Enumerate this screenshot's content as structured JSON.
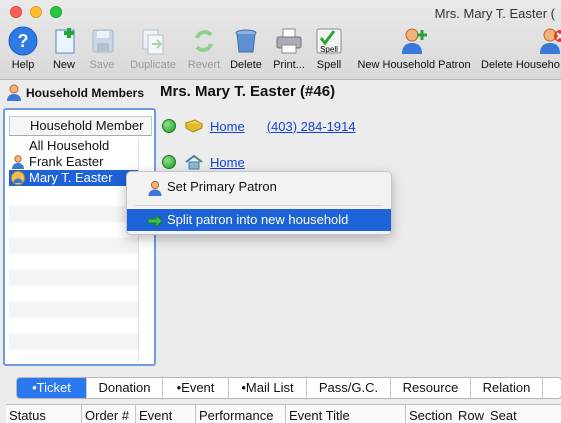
{
  "window": {
    "title": "Mrs. Mary T. Easter ("
  },
  "toolbar": [
    {
      "label": "Help",
      "icon": "help-icon",
      "enabled": true
    },
    {
      "label": "New",
      "icon": "new-document-icon",
      "enabled": true
    },
    {
      "label": "Save",
      "icon": "save-disk-icon",
      "enabled": false
    },
    {
      "label": "Duplicate",
      "icon": "duplicate-icon",
      "enabled": false
    },
    {
      "label": "Revert",
      "icon": "revert-arrows-icon",
      "enabled": false
    },
    {
      "label": "Delete",
      "icon": "trash-can-icon",
      "enabled": true
    },
    {
      "label": "Print...",
      "icon": "printer-icon",
      "enabled": true
    },
    {
      "label": "Spell",
      "icon": "spell-check-icon",
      "icon_text": "Spell",
      "enabled": true
    },
    {
      "label": "New Household Patron",
      "icon": "add-person-icon",
      "enabled": true
    },
    {
      "label": "Delete Househo",
      "icon": "delete-person-icon",
      "enabled": true
    }
  ],
  "household_panel": {
    "title": "Household Members",
    "column_header": "Household Member",
    "rows": [
      {
        "name": "All Household",
        "icon": null,
        "selected": false
      },
      {
        "name": "Frank Easter",
        "icon": "person-icon",
        "selected": false
      },
      {
        "name": "Mary T. Easter",
        "icon": "primary-patron-icon",
        "selected": true
      }
    ]
  },
  "patron": {
    "heading": "Mrs. Mary T. Easter (#46)",
    "addresses": [
      {
        "label": "Home",
        "phone": "(403) 284-1914",
        "icon": "mail-envelope-icon"
      },
      {
        "label": "Home",
        "phone": "",
        "icon": "house-icon"
      }
    ]
  },
  "context_menu": {
    "items": [
      {
        "label": "Set Primary Patron",
        "icon": "person-icon",
        "highlighted": false
      },
      {
        "label": "Split patron into new household",
        "icon": "green-arrow-icon",
        "highlighted": true
      }
    ]
  },
  "tabs": [
    {
      "label": "•Ticket",
      "active": true
    },
    {
      "label": "Donation",
      "active": false
    },
    {
      "label": "•Event",
      "active": false
    },
    {
      "label": "•Mail List",
      "active": false
    },
    {
      "label": "Pass/G.C.",
      "active": false
    },
    {
      "label": "Resource",
      "active": false
    },
    {
      "label": "Relation",
      "active": false
    },
    {
      "label": "",
      "active": false
    }
  ],
  "grid_columns": [
    "Status",
    "Order #",
    "Event",
    "Performance",
    "Event Title",
    "Section",
    "Row",
    "Seat"
  ],
  "colors": {
    "selection": "#1d62d6",
    "active_tab": "#2a78f0",
    "link": "#1142d6"
  }
}
